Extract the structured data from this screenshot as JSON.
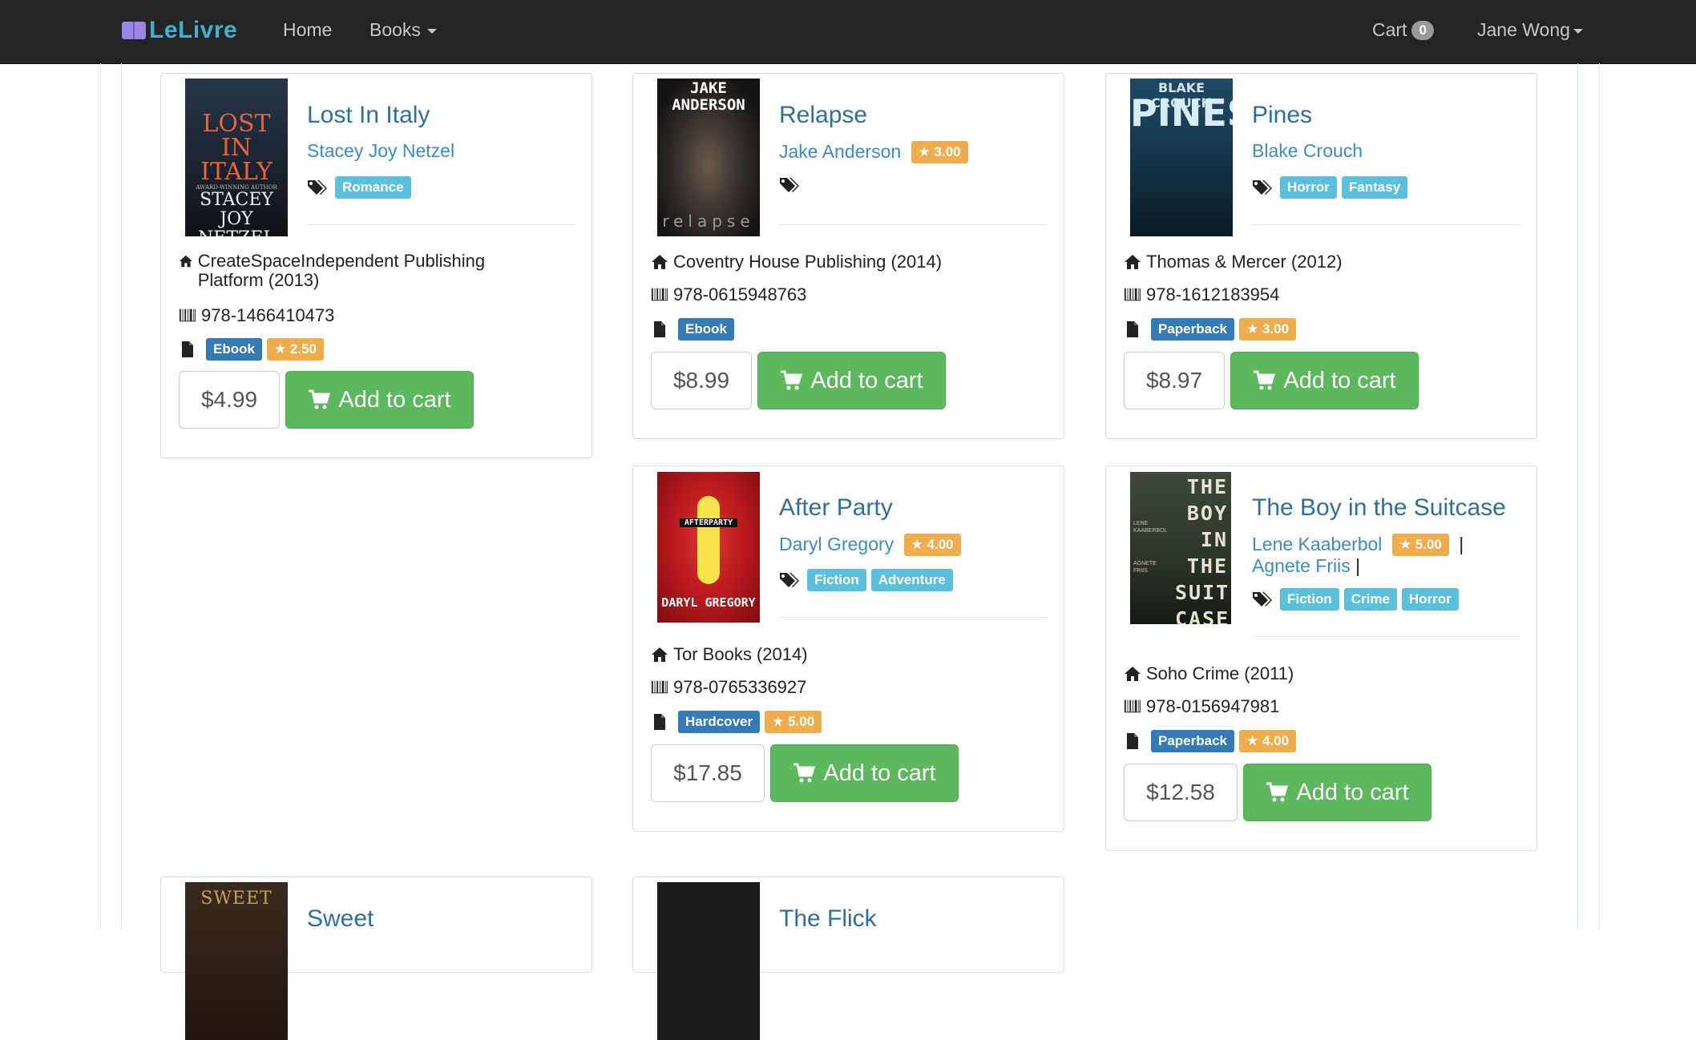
{
  "nav": {
    "brand": "LeLivre",
    "home": "Home",
    "books": "Books",
    "cart_label": "Cart",
    "cart_count": "0",
    "user": "Jane Wong"
  },
  "books": [
    {
      "title": "Lost In Italy",
      "authors": [
        {
          "name": "Stacey Joy Netzel",
          "rating": ""
        }
      ],
      "tags": [
        "Romance"
      ],
      "publisher": "CreateSpaceIndependent Publishing Platform (2013)",
      "isbn": "978-1466410473",
      "format": "Ebook",
      "rating": "★ 2.50",
      "price": "$4.99",
      "add_label": "Add to cart",
      "cover_text": [
        "LOST IN ITALY",
        "STACEY JOY NETZEL",
        "AWARD-WINNING AUTHOR"
      ]
    },
    {
      "title": "Relapse",
      "authors": [
        {
          "name": "Jake Anderson",
          "rating": "★ 3.00"
        }
      ],
      "tags": [],
      "publisher": "Coventry House Publishing (2014)",
      "isbn": "978-0615948763",
      "format": "Ebook",
      "rating": "",
      "price": "$8.99",
      "add_label": "Add to cart",
      "cover_text": [
        "JAKE ANDERSON",
        "relapse"
      ]
    },
    {
      "title": "Pines",
      "authors": [
        {
          "name": "Blake Crouch",
          "rating": ""
        }
      ],
      "tags": [
        "Horror",
        "Fantasy"
      ],
      "publisher": "Thomas & Mercer (2012)",
      "isbn": "978-1612183954",
      "format": "Paperback",
      "rating": "★ 3.00",
      "price": "$8.97",
      "add_label": "Add to cart",
      "cover_text": [
        "BLAKE CROUCH",
        "PINES"
      ]
    },
    {
      "title": "After Party",
      "authors": [
        {
          "name": "Daryl Gregory",
          "rating": "★ 4.00"
        }
      ],
      "tags": [
        "Fiction",
        "Adventure"
      ],
      "publisher": "Tor Books (2014)",
      "isbn": "978-0765336927",
      "format": "Hardcover",
      "rating": "★ 5.00",
      "price": "$17.85",
      "add_label": "Add to cart",
      "cover_text": [
        "AFTERPARTY",
        "DARYL GREGORY"
      ]
    },
    {
      "title": "The Boy in the Suitcase",
      "authors": [
        {
          "name": "Lene Kaaberbol",
          "rating": "★ 5.00"
        },
        {
          "name": "Agnete Friis",
          "rating": ""
        }
      ],
      "tags": [
        "Fiction",
        "Crime",
        "Horror"
      ],
      "publisher": "Soho Crime (2011)",
      "isbn": "978-0156947981",
      "format": "Paperback",
      "rating": "★ 4.00",
      "price": "$12.58",
      "add_label": "Add to cart",
      "cover_text": [
        "THE BOY IN THE SUIT CASE",
        "LENE KAABERBOL",
        "AGNETE FRIIS"
      ]
    },
    {
      "title": "Sweet",
      "cover_text": [
        "SWEET"
      ]
    },
    {
      "title": "The Flick",
      "cover_text": []
    }
  ],
  "colors": {
    "navbar": "#242424",
    "brand": "#3fb0cf",
    "link": "#3b8cc1",
    "success": "#5cb85c",
    "info": "#5bc0de",
    "primary": "#337ab7",
    "warning": "#f0ad4e"
  },
  "icons": {
    "publisher": "home-icon",
    "isbn": "barcode-icon",
    "format": "file-icon",
    "tags": "tags-icon",
    "cart": "shopping-cart-icon"
  }
}
